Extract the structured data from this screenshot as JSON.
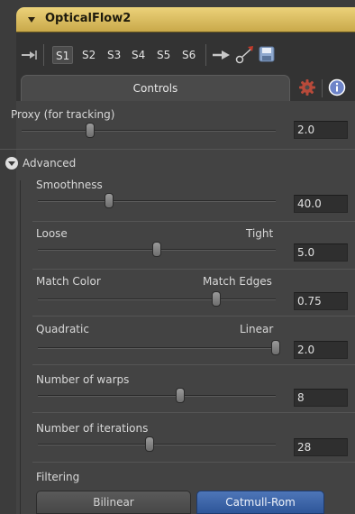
{
  "node": {
    "title": "OpticalFlow2"
  },
  "toolbar": {
    "slots": [
      "S1",
      "S2",
      "S3",
      "S4",
      "S5",
      "S6"
    ],
    "active_slot": "S1"
  },
  "tabs": {
    "controls_label": "Controls"
  },
  "proxy": {
    "label": "Proxy (for tracking)",
    "value": "2.0",
    "level": 0.27
  },
  "advanced": {
    "label": "Advanced"
  },
  "smoothness": {
    "label": "Smoothness",
    "value": "40.0",
    "level": 0.3
  },
  "loose_tight": {
    "left_label": "Loose",
    "right_label": "Tight",
    "value": "5.0",
    "level": 0.5
  },
  "match": {
    "left_label": "Match Color",
    "right_label": "Match Edges",
    "value": "0.75",
    "level": 0.75
  },
  "quadratic_linear": {
    "left_label": "Quadratic",
    "right_label": "Linear",
    "value": "2.0",
    "level": 1.0
  },
  "warps": {
    "label": "Number of warps",
    "value": "8",
    "level": 0.6
  },
  "iterations": {
    "label": "Number of iterations",
    "value": "28",
    "level": 0.47
  },
  "filtering": {
    "label": "Filtering",
    "options": [
      "Bilinear",
      "Catmull-Rom"
    ],
    "selected": "Catmull-Rom"
  },
  "colors": {
    "title_bar": "#d8bb5c",
    "panel_bg": "#434343",
    "accent_blue": "#3a63a8",
    "gear_red": "#b84a3a"
  }
}
